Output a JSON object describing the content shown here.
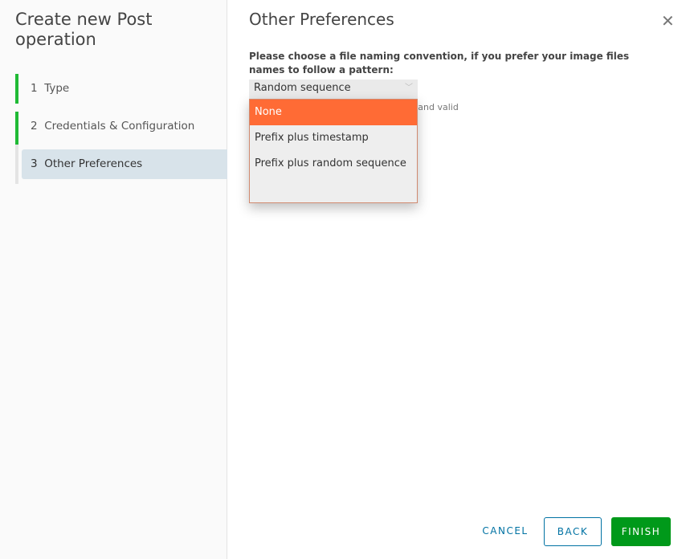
{
  "sidebar": {
    "title": "Create new Post operation",
    "steps": [
      {
        "num": "1",
        "label": "Type"
      },
      {
        "num": "2",
        "label": "Credentials & Configuration"
      },
      {
        "num": "3",
        "label": "Other Preferences"
      }
    ]
  },
  "main": {
    "title": "Other Preferences",
    "question": "Please choose a file naming convention, if you prefer your image files names to follow a pattern:",
    "select_value": "Random sequence",
    "helper_fragment": "e and valid",
    "options": [
      "None",
      "Prefix plus timestamp",
      "Prefix plus random sequence"
    ],
    "highlight_color": "#ff6b35"
  },
  "footer": {
    "cancel": "CANCEL",
    "back": "BACK",
    "finish": "FINISH"
  }
}
